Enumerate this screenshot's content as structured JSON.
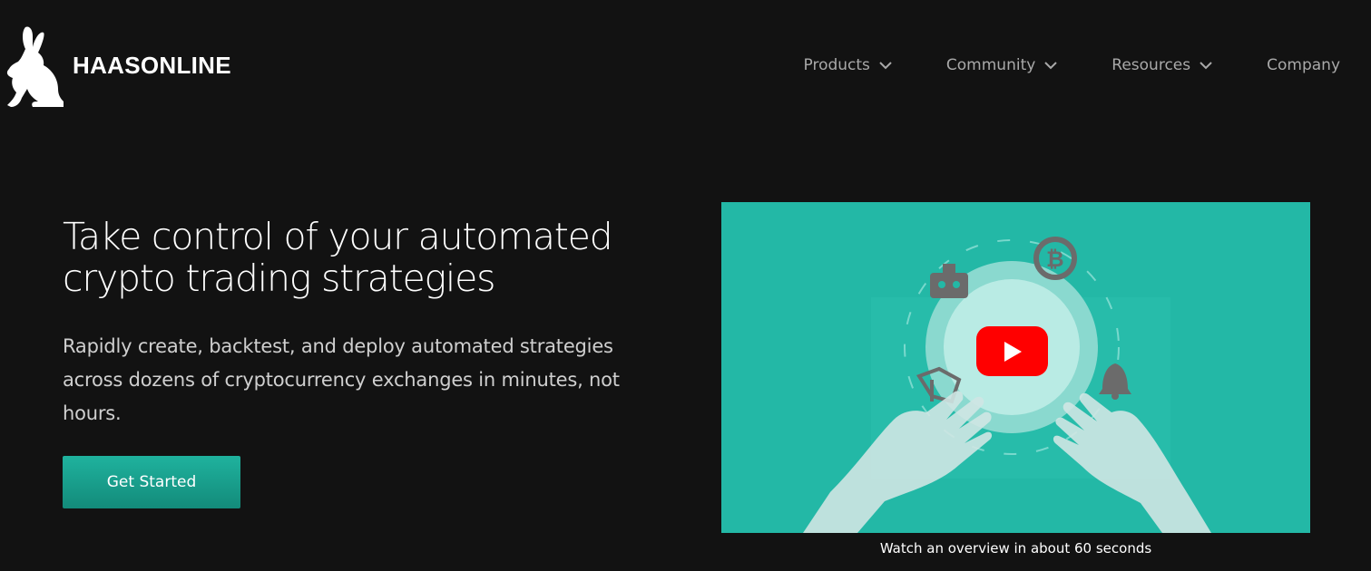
{
  "brand": {
    "name": "HAASONLINE",
    "logo_icon": "rabbit-icon"
  },
  "nav": {
    "items": [
      {
        "label": "Products",
        "has_dropdown": true
      },
      {
        "label": "Community",
        "has_dropdown": true
      },
      {
        "label": "Resources",
        "has_dropdown": true
      },
      {
        "label": "Company",
        "has_dropdown": false
      }
    ]
  },
  "hero": {
    "title": "Take control of your automated crypto trading strategies",
    "subtitle": "Rapidly create, backtest, and deploy automated strategies across dozens of cryptocurrency exchanges in minutes, not hours.",
    "cta_label": "Get Started"
  },
  "video": {
    "caption": "Watch an overview in about 60 seconds",
    "play_icon": "youtube-play-icon",
    "icons": [
      "robot-icon",
      "bitcoin-icon",
      "bell-icon",
      "chart-icon",
      "hands-icon"
    ]
  },
  "colors": {
    "background": "#121212",
    "accent": "#1fb29e",
    "video_background": "#23b8a6",
    "play_red": "#ff0000",
    "nav_text": "#a9a9a9"
  }
}
